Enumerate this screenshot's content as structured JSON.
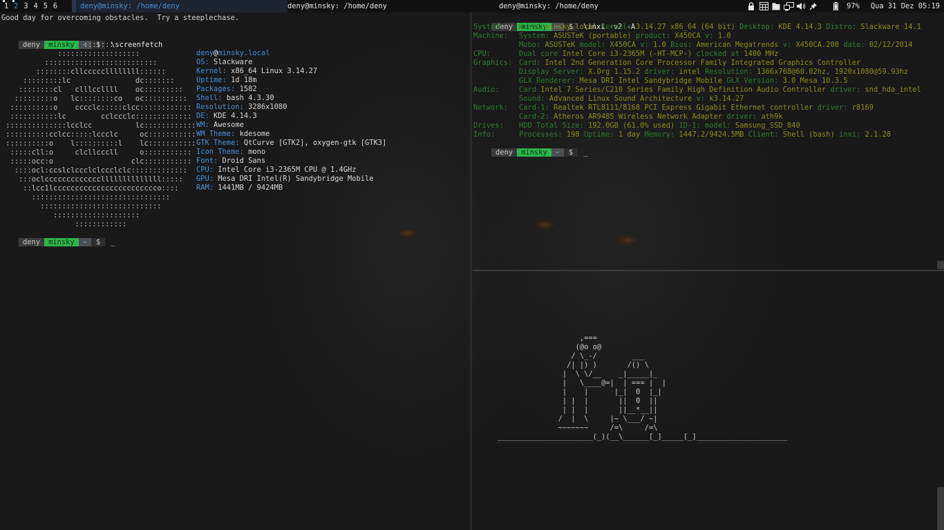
{
  "topbar": {
    "tags": [
      {
        "label": "1",
        "selected": false,
        "occupied": true
      },
      {
        "label": "2",
        "selected": true,
        "occupied": true
      },
      {
        "label": "3",
        "selected": false,
        "occupied": false
      },
      {
        "label": "4",
        "selected": false,
        "occupied": false
      },
      {
        "label": "5",
        "selected": false,
        "occupied": false
      },
      {
        "label": "6",
        "selected": false,
        "occupied": false
      }
    ],
    "tasks": [
      {
        "title": "deny@minsky: /home/deny"
      },
      {
        "title": "deny@minsky: /home/deny"
      },
      {
        "title": "deny@minsky: /home/deny"
      }
    ],
    "tray_icons": [
      "lock-icon",
      "calendar-icon",
      "folder-icon",
      "network-icon",
      "volume-icon",
      "pin-icon",
      "battery-icon"
    ],
    "battery": "97%",
    "clock": "Qua 31 Dez 05:19"
  },
  "left": {
    "fortune": "Good day for overcoming obstacles.  Try a steeplechase.",
    "prompt": {
      "user": "deny",
      "host": "minsky",
      "dir": "~",
      "symbol": "$"
    },
    "command": "\\screenfetch",
    "cursor": "_",
    "logo_lines": [
      "                   :::::::",
      "             :::::::::::::::::::",
      "          ::::::::::::::::::::::::::",
      "        ::::::::cllcccccllllllll::::::",
      "     :::::::::lc               dc:::::::",
      "    ::::::::cl   clllccllll    oc:::::::::",
      "   :::::::::o   lc::::::::co   oc::::::::::",
      "  ::::::::::o    cccclc:::::clcc::::::::::::",
      "  :::::::::::lc        cclccclc:::::::::::::",
      " ::::::::::::::lcclcc          lc::::::::::::",
      " ::::::::::cclcc:::::lccclc     oc:::::::::::",
      " ::::::::::o    l::::::::::l    lc:::::::::::",
      "  :::::cll:o     clcllcccll     o:::::::::::",
      "  :::::occ:o                  clc:::::::::::",
      "   ::::ocl:ccslclccclclccclclc:::::::::::::",
      "    :::oclcccccccccccccllllllllllllll:::::",
      "     ::lcc1lcccccccccccccccccccccccco::::",
      "       ::::::::::::::::::::::::::::::::",
      "         ::::::::::::::::::::::::::::",
      "            ::::::::::::::::::::",
      "                 ::::::::::::"
    ],
    "info": {
      "user": "deny",
      "at": "@",
      "host": "minsky.local",
      "rows": [
        {
          "key": "OS:",
          "value": "Slackware"
        },
        {
          "key": "Kernel:",
          "value": "x86_64 Linux 3.14.27"
        },
        {
          "key": "Uptime:",
          "value": "1d 18m"
        },
        {
          "key": "Packages:",
          "value": "1582"
        },
        {
          "key": "Shell:",
          "value": "bash 4.3.30"
        },
        {
          "key": "Resolution:",
          "value": "3286x1080"
        },
        {
          "key": "DE:",
          "value": "KDE 4.14.3"
        },
        {
          "key": "WM:",
          "value": "Awesome"
        },
        {
          "key": "WM Theme:",
          "value": "kdesome"
        },
        {
          "key": "GTK Theme:",
          "value": "QtCurve [GTK2], oxygen-gtk [GTK3]"
        },
        {
          "key": "Icon Theme:",
          "value": "mono"
        },
        {
          "key": "Font:",
          "value": "Droid Sans"
        },
        {
          "key": "CPU:",
          "value": "Intel Core i3-2365M CPU @ 1.4GHz"
        },
        {
          "key": "GPU:",
          "value": "Mesa DRI Intel(R) Sandybridge Mobile"
        },
        {
          "key": "RAM:",
          "value": "1441MB / 9424MB"
        }
      ]
    }
  },
  "right_top": {
    "prompt": {
      "user": "deny",
      "host": "minsky",
      "dir": "~",
      "symbol": "$"
    },
    "command": "\\inxi -v2 -A",
    "cursor": "_",
    "rows": [
      {
        "label": "System:",
        "parts": [
          [
            "g",
            "Host:"
          ],
          [
            "y",
            "minsky.local"
          ],
          [
            "g",
            "Kernel:"
          ],
          [
            "y",
            "3.14.27 x86_64 (64 bit)"
          ],
          [
            "g",
            "Desktop:"
          ],
          [
            "y",
            "KDE 4.14.3"
          ],
          [
            "g",
            "Distro:"
          ],
          [
            "y",
            "Slackware 14.1"
          ]
        ]
      },
      {
        "label": "Machine:",
        "parts": [
          [
            "g",
            "System:"
          ],
          [
            "y",
            "ASUSTeK (portable)"
          ],
          [
            "g",
            "product:"
          ],
          [
            "y",
            "X450CA"
          ],
          [
            "g",
            "v:"
          ],
          [
            "y",
            "1.0"
          ]
        ]
      },
      {
        "label": "",
        "parts": [
          [
            "g",
            "Mobo:"
          ],
          [
            "y",
            "ASUSTeK"
          ],
          [
            "g",
            "model:"
          ],
          [
            "y",
            "X450CA"
          ],
          [
            "g",
            "v:"
          ],
          [
            "y",
            "1.0"
          ],
          [
            "g",
            "Bios:"
          ],
          [
            "y",
            "American Megatrends"
          ],
          [
            "g",
            "v:"
          ],
          [
            "y",
            "X450CA.208"
          ],
          [
            "g",
            "date:"
          ],
          [
            "y",
            "02/12/2014"
          ]
        ]
      },
      {
        "label": "CPU:",
        "parts": [
          [
            "g",
            "Dual core"
          ],
          [
            "y",
            "Intel Core i3-2365M (-HT-MCP-)"
          ],
          [
            "g",
            "clocked at"
          ],
          [
            "y",
            "1400 MHz"
          ]
        ]
      },
      {
        "label": "Graphics:",
        "parts": [
          [
            "g",
            "Card:"
          ],
          [
            "y",
            "Intel 2nd Generation Core Processor Family Integrated Graphics Controller"
          ]
        ]
      },
      {
        "label": "",
        "parts": [
          [
            "g",
            "Display Server:"
          ],
          [
            "y",
            "X.Org 1.15.2"
          ],
          [
            "g",
            "driver:"
          ],
          [
            "y",
            "intel"
          ],
          [
            "g",
            "Resolution:"
          ],
          [
            "y",
            "1366x768@60.02hz, 1920x1080@59.93hz"
          ]
        ]
      },
      {
        "label": "",
        "parts": [
          [
            "g",
            "GLX Renderer:"
          ],
          [
            "y",
            "Mesa DRI Intel Sandybridge Mobile"
          ],
          [
            "g",
            "GLX Version:"
          ],
          [
            "y",
            "3.0 Mesa 10.3.5"
          ]
        ]
      },
      {
        "label": "Audio:",
        "parts": [
          [
            "g",
            "Card"
          ],
          [
            "y",
            "Intel 7 Series/C210 Series Family High Definition Audio Controller"
          ],
          [
            "g",
            "driver:"
          ],
          [
            "y",
            "snd_hda_intel"
          ]
        ]
      },
      {
        "label": "",
        "parts": [
          [
            "g",
            "Sound:"
          ],
          [
            "y",
            "Advanced Linux Sound Architecture"
          ],
          [
            "g",
            "v:"
          ],
          [
            "y",
            "k3.14.27"
          ]
        ]
      },
      {
        "label": "Network:",
        "parts": [
          [
            "g",
            "Card-1:"
          ],
          [
            "y",
            "Realtek RTL8111/8168 PCI Express Gigabit Ethernet controller"
          ],
          [
            "g",
            "driver:"
          ],
          [
            "y",
            "r8169"
          ]
        ]
      },
      {
        "label": "",
        "parts": [
          [
            "g",
            "Card-2:"
          ],
          [
            "y",
            "Atheros AR9485 Wireless Network Adapter"
          ],
          [
            "g",
            "driver:"
          ],
          [
            "y",
            "ath9k"
          ]
        ]
      },
      {
        "label": "Drives:",
        "parts": [
          [
            "g",
            "HDD Total Size:"
          ],
          [
            "y",
            "192.0GB (61.0% used)"
          ],
          [
            "g",
            "ID-1:"
          ],
          [
            "g",
            "model:"
          ],
          [
            "y",
            "Samsung_SSD_840"
          ]
        ]
      },
      {
        "label": "Info:",
        "parts": [
          [
            "g",
            "Processes:"
          ],
          [
            "y",
            "198"
          ],
          [
            "g",
            "Uptime:"
          ],
          [
            "y",
            "1 day"
          ],
          [
            "g",
            "Memory:"
          ],
          [
            "y",
            "1447.2/9424.5MB"
          ],
          [
            "g",
            "Client:"
          ],
          [
            "y",
            "Shell (bash)"
          ],
          [
            "g",
            "inxi:"
          ],
          [
            "y",
            "2.1.28"
          ]
        ]
      }
    ]
  },
  "right_bottom": {
    "art_lines": [
      "                   ,===",
      "                  (@o o@",
      "                 / \\_-/        ___",
      "                /| |) )       /() \\",
      "               |  \\ \\/__    _|_____|_",
      "               |   \\____@=|  | === |  |",
      "               |    |      |_|  0  |_|",
      "               | |  |       ||  0  ||",
      "               | |  |       ||__*__||",
      "              /  |  \\     |~ \\___/ ~|",
      "              ~~~~~~~     /=\\     /=\\",
      "______________________(_)(__\\______[_]_____[_]_____________________"
    ]
  }
}
